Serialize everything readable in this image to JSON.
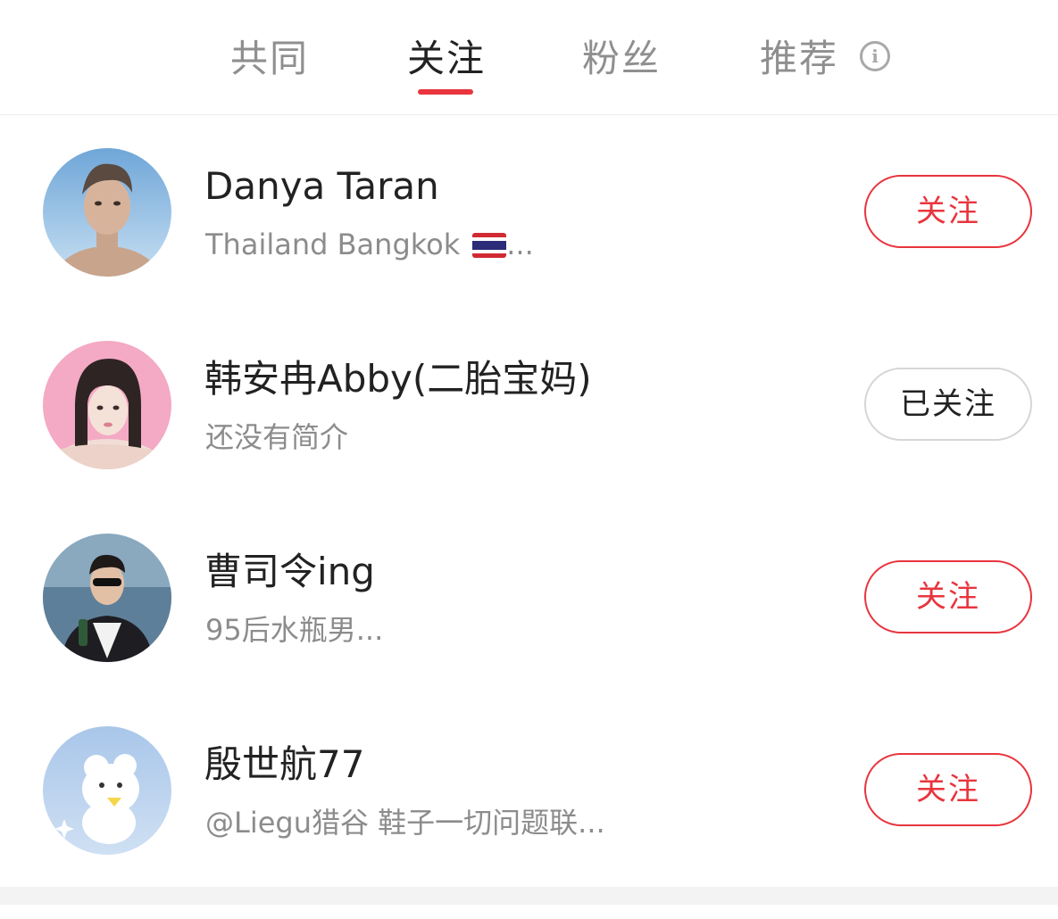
{
  "tabs": [
    {
      "label": "共同",
      "active": false
    },
    {
      "label": "关注",
      "active": true
    },
    {
      "label": "粉丝",
      "active": false
    },
    {
      "label": "推荐",
      "active": false
    }
  ],
  "info_icon": "info-icon",
  "users": [
    {
      "name": "Danya Taran",
      "bio": "Thailand Bangkok",
      "bio_suffix": "...",
      "button": "关注",
      "following": false
    },
    {
      "name": "韩安冉Abby(二胎宝妈)",
      "bio": "还没有简介",
      "button": "已关注",
      "following": true
    },
    {
      "name": "曹司令ing",
      "bio": "95后水瓶男...",
      "button": "关注",
      "following": false
    },
    {
      "name": "殷世航77",
      "bio": "@Liegu猎谷 鞋子一切问题联...",
      "button": "关注",
      "following": false
    }
  ],
  "colors": {
    "accent": "#e8353e",
    "text": "#222222",
    "muted": "#8c8c8c"
  }
}
